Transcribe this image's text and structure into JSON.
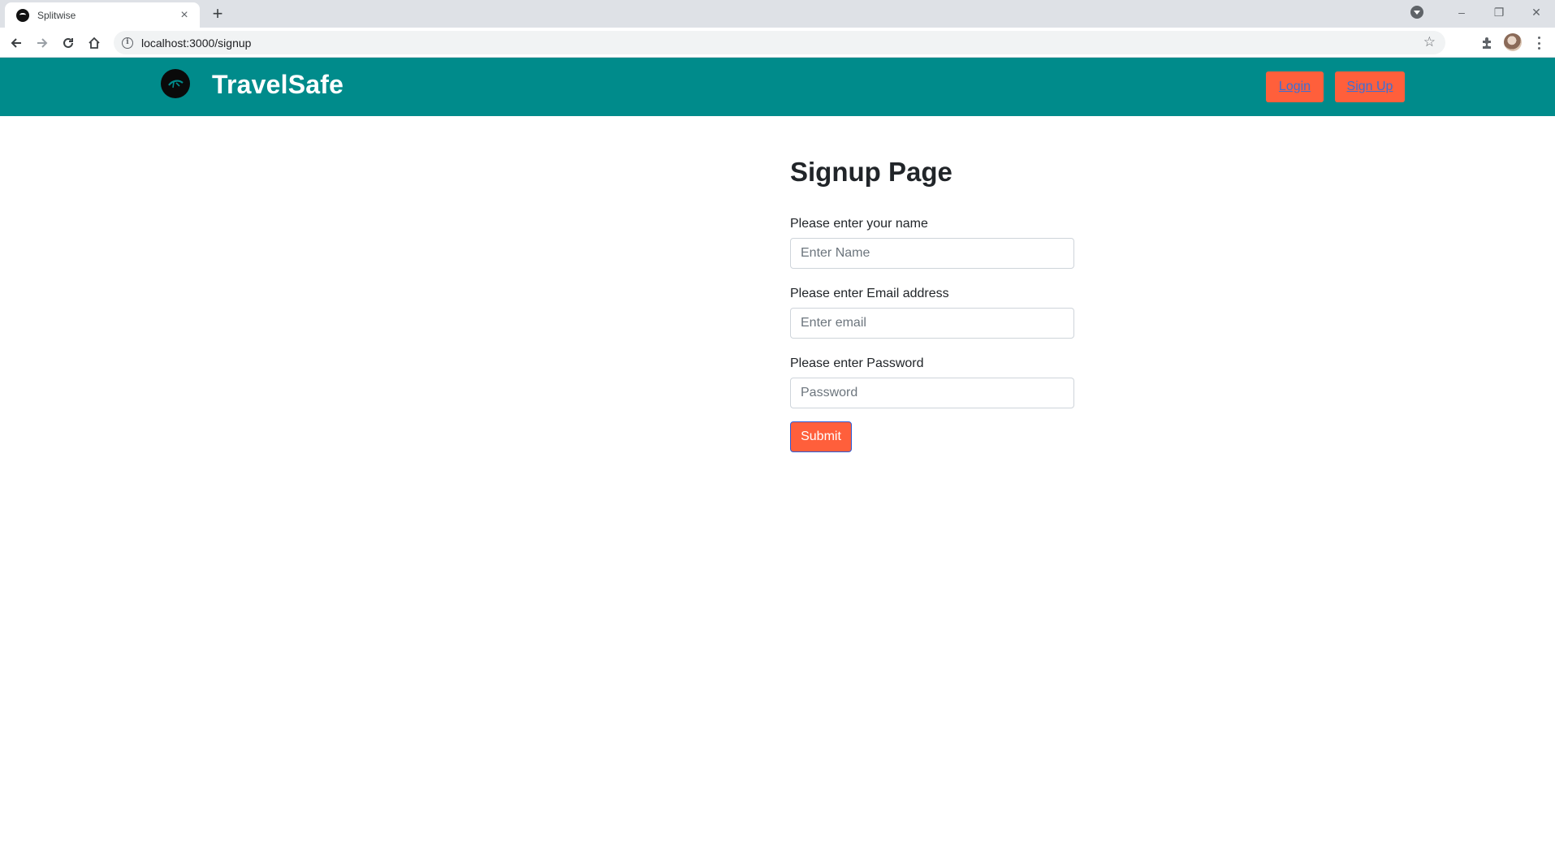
{
  "browser": {
    "tab_title": "Splitwise",
    "tab_close": "×",
    "new_tab": "+",
    "url": "localhost:3000/signup",
    "controls": {
      "minimize": "–",
      "restore": "❐",
      "close": "✕"
    }
  },
  "navbar": {
    "background": "#008b8b",
    "brand": "TravelSafe",
    "login_label": "Login",
    "signup_label": "Sign Up",
    "button_color": "#ff5f3b"
  },
  "form": {
    "title": "Signup Page",
    "name_label": "Please enter your name",
    "name_placeholder": "Enter Name",
    "email_label": "Please enter Email address",
    "email_placeholder": "Enter email",
    "password_label": "Please enter Password",
    "password_placeholder": "Password",
    "submit_label": "Submit"
  }
}
